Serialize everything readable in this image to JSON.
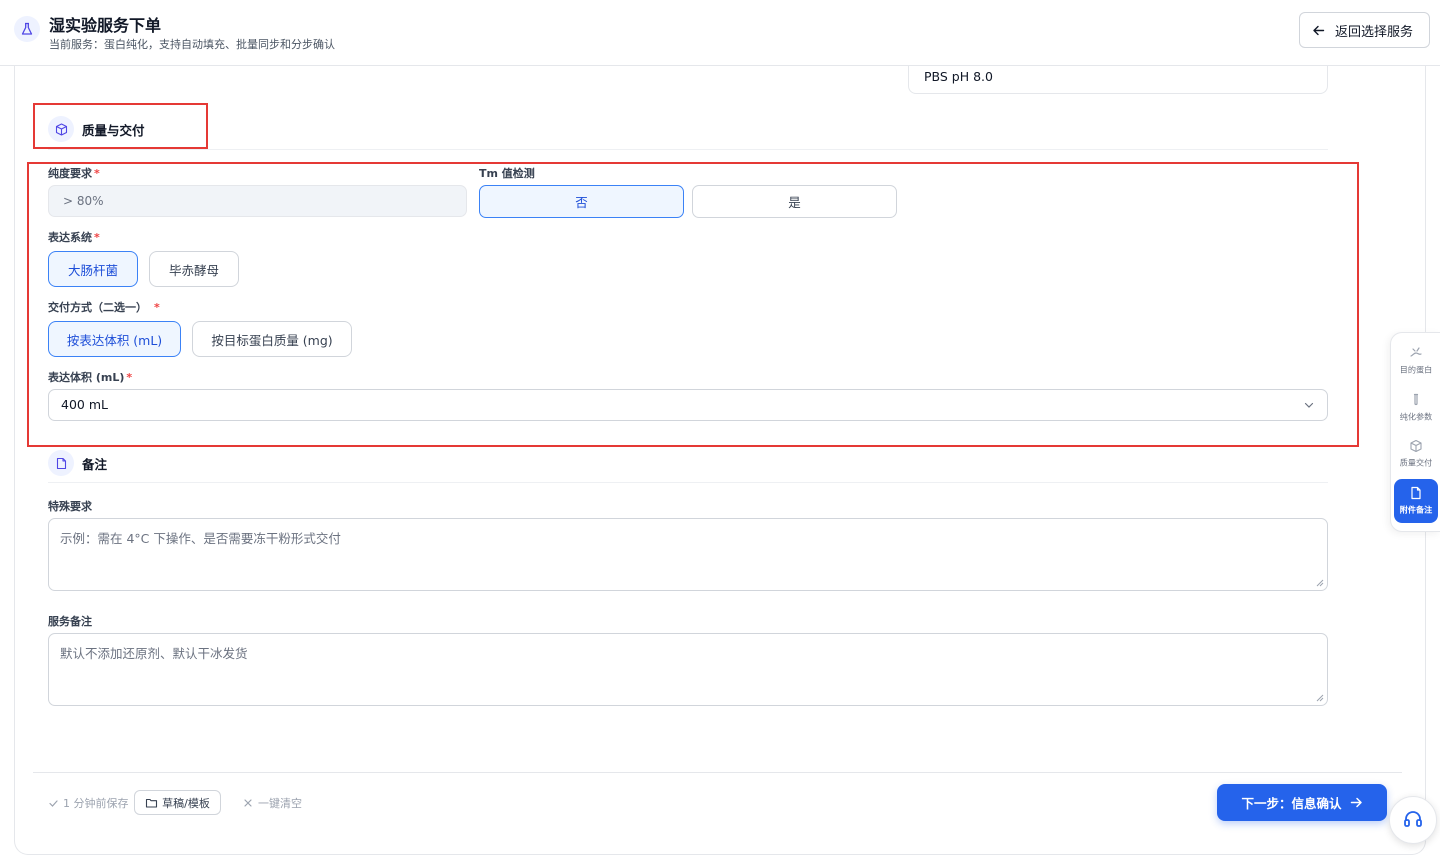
{
  "header": {
    "title": "湿实验服务下单",
    "subtitle": "当前服务：蛋白纯化，支持自动填充、批量同步和分步确认",
    "back_label": "返回选择服务"
  },
  "previous_field": {
    "value": "PBS pH 8.0"
  },
  "quality_section": {
    "title": "质量与交付",
    "purity": {
      "label": "纯度要求",
      "required_mark": "*",
      "value": "> 80%"
    },
    "tm": {
      "label": "Tm 值检测",
      "options": [
        "否",
        "是"
      ],
      "selected": "否"
    },
    "expression": {
      "label": "表达系统",
      "required_mark": "*",
      "options": [
        "大肠杆菌",
        "毕赤酵母"
      ],
      "selected": "大肠杆菌"
    },
    "delivery": {
      "label": "交付方式（二选一）",
      "required_mark": "*",
      "options": [
        "按表达体积 (mL)",
        "按目标蛋白质量 (mg)"
      ],
      "selected": "按表达体积 (mL)"
    },
    "volume": {
      "label": "表达体积 (mL)",
      "required_mark": "*",
      "value": "400 mL"
    }
  },
  "notes_section": {
    "title": "备注",
    "special": {
      "label": "特殊要求",
      "placeholder": "示例：需在 4°C 下操作、是否需要冻干粉形式交付"
    },
    "service": {
      "label": "服务备注",
      "placeholder": "默认不添加还原剂、默认干冰发货"
    }
  },
  "right_nav": {
    "items": [
      {
        "label": "目的蛋白",
        "icon": "protein-icon"
      },
      {
        "label": "纯化参数",
        "icon": "test-tube-icon"
      },
      {
        "label": "质量交付",
        "icon": "box-icon"
      },
      {
        "label": "附件备注",
        "icon": "file-icon"
      }
    ],
    "active": "附件备注"
  },
  "footer": {
    "saved_text": "1 分钟前保存",
    "draft_label": "草稿/模板",
    "clear_label": "一键清空",
    "next_label": "下一步：信息确认"
  },
  "colors": {
    "accent": "#2563eb",
    "highlight_border": "#e53935",
    "required": "#ef4444"
  }
}
